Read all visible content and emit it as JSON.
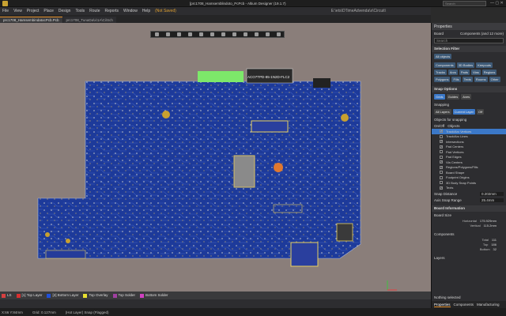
{
  "title": "[prc1708_Hamsemblindoto_PcPcb - Altium Designer (19.1.7)",
  "menu": [
    "File",
    "View",
    "Project",
    "Place",
    "Design",
    "Tools",
    "Route",
    "Reports",
    "Window",
    "Help"
  ],
  "not_saved": "(Not Saved)",
  "path_label": "E:\\ets\\DTimeAdvenda\\x\\Circuit\\",
  "search_placeholder": "Search",
  "tabs": [
    "prc1708_HamsembindatocPcb.Pcb",
    "prc1708_TunaDa\\x\\1A\\Ci\\Sch"
  ],
  "panel": {
    "title": "Properties",
    "board_label": "Board",
    "components_count": "Components (and 12 more)",
    "search": "Search",
    "selection_filter": "Selection Filter",
    "all_layers": "All objects",
    "filter_buttons": [
      "Components",
      "3D Bodies",
      "Keepouts",
      "Tracks",
      "Arcs",
      "Pads",
      "Vias",
      "Regions",
      "Polygons",
      "Fills",
      "Texts",
      "Rooms",
      "Other"
    ],
    "snap_options": "Snap Options",
    "snap_buttons": [
      "Grids",
      "Guides",
      "Axes"
    ],
    "snapping": "Snapping",
    "snap_layers": [
      "All Layers",
      "Current Layer",
      "Off"
    ],
    "objects_for_snapping": "Objects for snapping",
    "onoff": "On/Off",
    "objects": "Objects",
    "snap_objects": [
      {
        "label": "Track/Arc Vertices",
        "on": true,
        "sel": true
      },
      {
        "label": "Track/Arc Lines",
        "on": false
      },
      {
        "label": "Intersections",
        "on": true
      },
      {
        "label": "Pad Centers",
        "on": true
      },
      {
        "label": "Pad Vertices",
        "on": false
      },
      {
        "label": "Pad Edges",
        "on": false
      },
      {
        "label": "Via Centers",
        "on": true
      },
      {
        "label": "Regions/Polygons/Fills",
        "on": true
      },
      {
        "label": "Board Shape",
        "on": false
      },
      {
        "label": "Footprint Origins",
        "on": false
      },
      {
        "label": "3D Body Snap Points",
        "on": false
      },
      {
        "label": "Texts",
        "on": true
      }
    ],
    "snap_distance_label": "Snap Distance",
    "snap_distance": "0.202mm",
    "axis_snap_label": "Axis Snap Range",
    "axis_snap": "25.4mm",
    "board_info": "Board Information",
    "board_size": "Board Size",
    "horizontal_label": "Horizontal",
    "horizontal": "175.929mm",
    "vertical_label": "Vertical",
    "vertical": "115.2mm",
    "components": "Components",
    "total_label": "Total",
    "total": "111",
    "top_label": "Top",
    "top": "186",
    "bottom_label": "Bottom",
    "bottom": "32",
    "layers": "Layers",
    "nothing_selected": "Nothing selected",
    "bottom_tabs": [
      "Properties",
      "Components",
      "Manufacturing"
    ]
  },
  "layers": [
    {
      "label": "LS",
      "color": "#d84040"
    },
    {
      "label": "[1] Top Layer",
      "color": "#d83030"
    },
    {
      "label": "[2] Bottom Layer",
      "color": "#2050d8"
    },
    {
      "label": "Top Overlay",
      "color": "#e8e030"
    },
    {
      "label": "Top Solder",
      "color": "#a040a0"
    },
    {
      "label": "Bottom Solder",
      "color": "#d040c0"
    }
  ],
  "status": [
    "X:66 Y:84mm",
    "Grid: 0.127mm",
    "(Hot Layer) Snap (Flagged)"
  ],
  "pcb_label": "ACO7TPD-85-1N2D-FLC2"
}
